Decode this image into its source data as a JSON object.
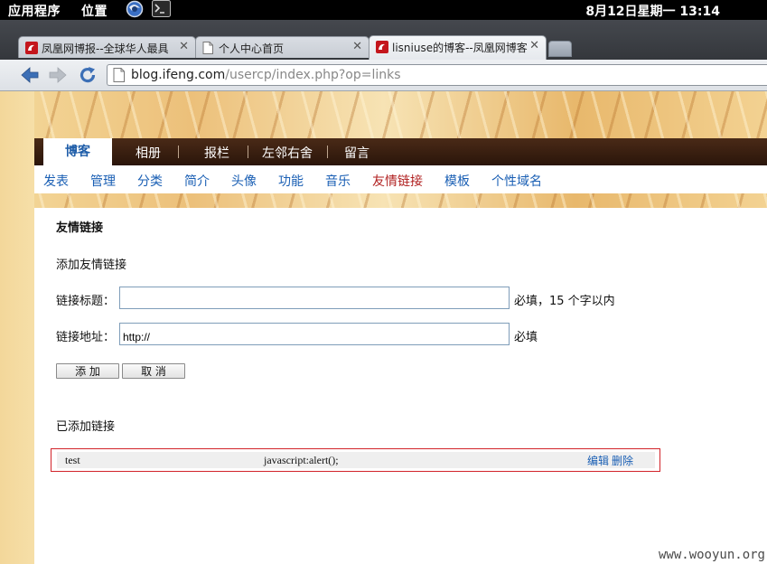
{
  "panel": {
    "menu_apps": "应用程序",
    "menu_places": "位置",
    "clock": "8月12日星期一 13:14"
  },
  "tabs": [
    {
      "title": "凤凰网博报--全球华人最具",
      "active": false,
      "icon": "ifeng-favicon"
    },
    {
      "title": "个人中心首页",
      "active": false,
      "icon": "page-icon"
    },
    {
      "title": "lisniuse的博客--凤凰网博客",
      "active": true,
      "icon": "ifeng-favicon"
    }
  ],
  "address": {
    "host": "blog.ifeng.com",
    "path": "/usercp/index.php?op=links"
  },
  "main_nav": [
    "博客",
    "相册",
    "报栏",
    "左邻右舍",
    "留言"
  ],
  "sub_nav": [
    "发表",
    "管理",
    "分类",
    "简介",
    "头像",
    "功能",
    "音乐",
    "友情链接",
    "模板",
    "个性域名"
  ],
  "sub_nav_current": "友情链接",
  "content": {
    "section_title": "友情链接",
    "add_heading": "添加友情链接",
    "title_label": "链接标题：",
    "title_value": "",
    "title_hint": "必填，15 个字以内",
    "url_label": "链接地址：",
    "url_value": "http://",
    "url_hint": "必填",
    "add_button": "添 加",
    "cancel_button": "取 消",
    "added_heading": "已添加链接",
    "links": [
      {
        "name": "test",
        "url": "javascript:alert();",
        "edit": "编辑",
        "delete": "删除"
      }
    ]
  },
  "watermark": "www.wooyun.org",
  "colors": {
    "link": "#1a5fb4",
    "current_subnav": "#b01f1f",
    "highlight_border": "#d2232a",
    "nav_bar": "#3a2010"
  }
}
